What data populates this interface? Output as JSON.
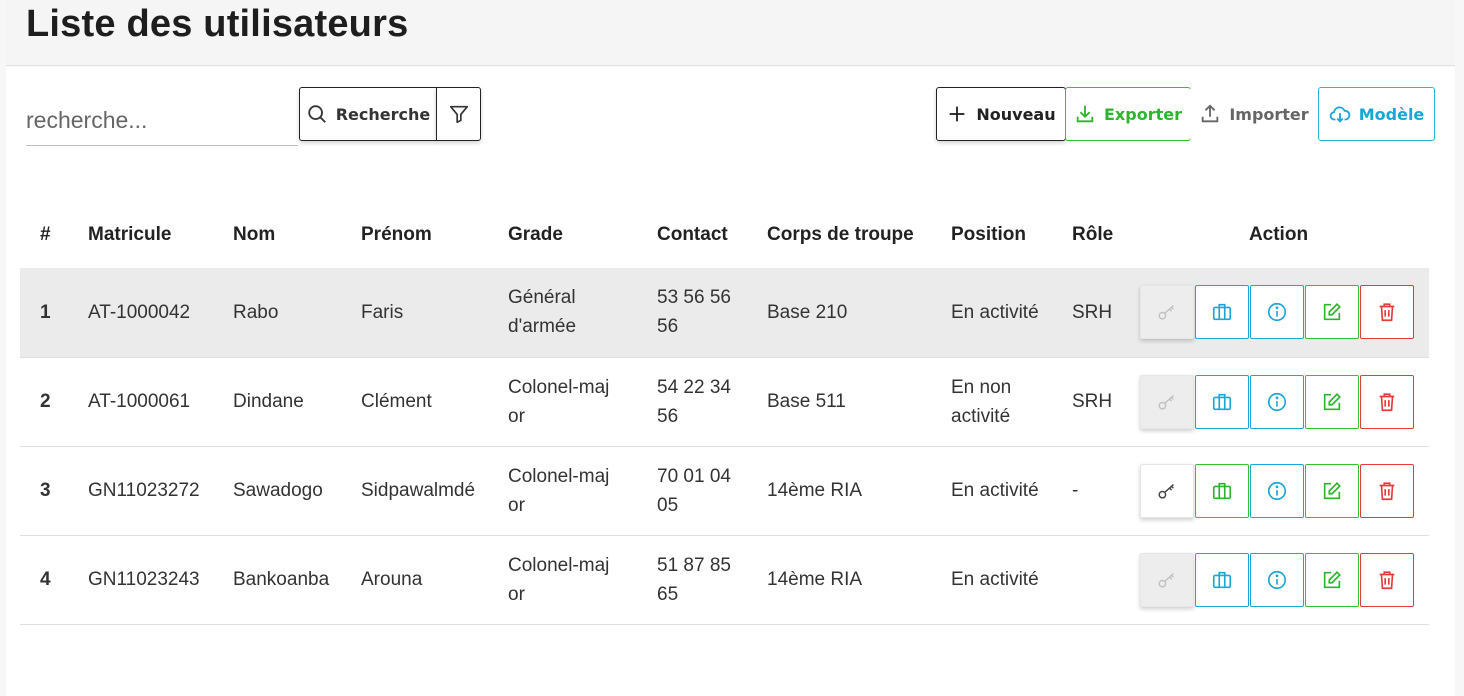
{
  "header": {
    "title": "Liste des utilisateurs"
  },
  "toolbar": {
    "search_placeholder": "recherche...",
    "search_label": "Recherche",
    "new_label": "Nouveau",
    "export_label": "Exporter",
    "import_label": "Importer",
    "template_label": "Modèle"
  },
  "colors": {
    "export": "#2db52d",
    "template": "#19a7d6",
    "delete": "#e63b3b",
    "info": "#1ba6d8"
  },
  "table": {
    "columns": [
      "#",
      "Matricule",
      "Nom",
      "Prénom",
      "Grade",
      "Contact",
      "Corps de troupe",
      "Position",
      "Rôle",
      "Action"
    ],
    "rows": [
      {
        "num": "1",
        "matricule": "AT-1000042",
        "nom": "Rabo",
        "prenom": "Faris",
        "grade": "Général d'armée",
        "contact": "53 56 56 56",
        "corps": "Base 210",
        "position": "En activité",
        "role": "SRH"
      },
      {
        "num": "2",
        "matricule": "AT-1000061",
        "nom": "Dindane",
        "prenom": "Clément",
        "grade": "Colonel-major",
        "contact": "54 22 34 56",
        "corps": "Base 511",
        "position": "En non activité",
        "role": "SRH"
      },
      {
        "num": "3",
        "matricule": "GN11023272",
        "nom": "Sawadogo",
        "prenom": "Sidpawalmdé",
        "grade": "Colonel-major",
        "contact": "70 01 04 05",
        "corps": "14ème RIA",
        "position": "En activité",
        "role": "-"
      },
      {
        "num": "4",
        "matricule": "GN11023243",
        "nom": "Bankoanba",
        "prenom": "Arouna",
        "grade": "Colonel-major",
        "contact": "51 87 85 65",
        "corps": "14ème RIA",
        "position": "En activité",
        "role": ""
      }
    ]
  }
}
